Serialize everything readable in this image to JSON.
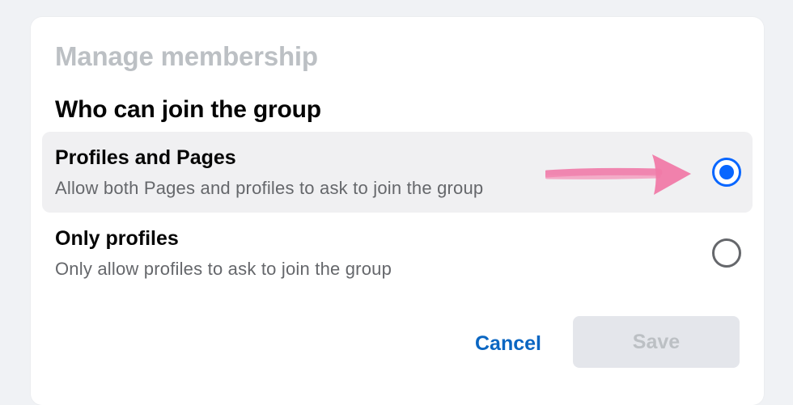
{
  "dialog": {
    "title": "Manage membership",
    "section_title": "Who can join the group"
  },
  "options": [
    {
      "label": "Profiles and Pages",
      "description": "Allow both Pages and profiles to ask to join the group",
      "selected": true
    },
    {
      "label": "Only profiles",
      "description": "Only allow profiles to ask to join the group",
      "selected": false
    }
  ],
  "actions": {
    "cancel_label": "Cancel",
    "save_label": "Save",
    "save_enabled": false
  },
  "colors": {
    "accent": "#0866ff",
    "link": "#0a66c2",
    "annotation_arrow": "#f07aa8"
  },
  "annotation": {
    "icon": "arrow-right-icon"
  }
}
